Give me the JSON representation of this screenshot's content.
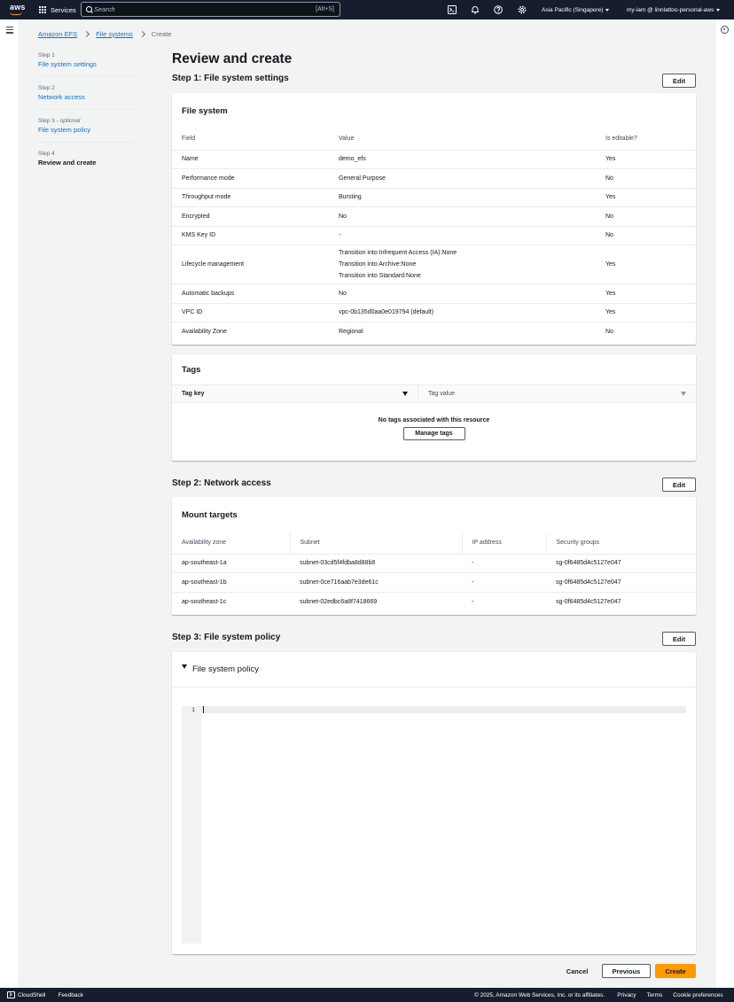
{
  "topnav": {
    "logo_text": "aws",
    "services_label": "Services",
    "search_placeholder": "Search",
    "search_shortcut": "[Alt+S]",
    "icons": [
      "cloudshell-icon",
      "bell-icon",
      "help-icon",
      "gear-icon"
    ],
    "region": "Asia Pacific (Singapore)",
    "user": "my-iam @ linnlattoo-personal-aws",
    "colors": {
      "bg": "#161e2d",
      "logo_smile": "#ff9900"
    }
  },
  "breadcrumb": {
    "items": [
      "Amazon EFS",
      "File systems"
    ],
    "current": "Create"
  },
  "steps": [
    {
      "num": "Step 1",
      "optional": "",
      "name": "File system settings"
    },
    {
      "num": "Step 2",
      "optional": "",
      "name": "Network access"
    },
    {
      "num": "Step 3",
      "optional": "optional",
      "name": "File system policy"
    },
    {
      "num": "Step 4",
      "optional": "",
      "name": "Review and create"
    }
  ],
  "page": {
    "title": "Review and create",
    "edit_label": "Edit"
  },
  "step1": {
    "title": "Step 1: File system settings",
    "file_system": {
      "header": "File system",
      "columns": [
        "Field",
        "Value",
        "Is editable?"
      ],
      "rows": [
        {
          "field": "Name",
          "value": [
            "demo_efs"
          ],
          "editable": "Yes"
        },
        {
          "field": "Performance mode",
          "value": [
            "General Purpose"
          ],
          "editable": "No"
        },
        {
          "field": "Throughput mode",
          "value": [
            "Bursting"
          ],
          "editable": "Yes"
        },
        {
          "field": "Encrypted",
          "value": [
            "No"
          ],
          "editable": "No"
        },
        {
          "field": "KMS Key ID",
          "value": [
            "-"
          ],
          "editable": "No"
        },
        {
          "field": "Lifecycle management",
          "value": [
            "Transition into Infrequent Access (IA):None",
            "Transition into Archive:None",
            "Transition into Standard:None"
          ],
          "editable": "Yes"
        },
        {
          "field": "Automatic backups",
          "value": [
            "No"
          ],
          "editable": "Yes"
        },
        {
          "field": "VPC ID",
          "value": [
            "vpc-0b135d0aa0e019794 (default)"
          ],
          "editable": "Yes"
        },
        {
          "field": "Availability Zone",
          "value": [
            "Regional"
          ],
          "editable": "No"
        }
      ]
    },
    "tags": {
      "header": "Tags",
      "col_key": "Tag key",
      "col_value": "Tag value",
      "empty": "No tags associated with this resource",
      "manage_label": "Manage tags"
    }
  },
  "step2": {
    "title": "Step 2: Network access",
    "mount_targets": {
      "header": "Mount targets",
      "columns": [
        "Availability zone",
        "Subnet",
        "IP address",
        "Security groups"
      ],
      "rows": [
        [
          "ap-southeast-1a",
          "subnet-03cd5f4fdba8d88b8",
          "-",
          "sg-0f6485d4c5127e047"
        ],
        [
          "ap-southeast-1b",
          "subnet-0ce716aab7e3de61c",
          "-",
          "sg-0f6485d4c5127e047"
        ],
        [
          "ap-southeast-1c",
          "subnet-02edbc6a8f7418669",
          "-",
          "sg-0f6485d4c5127e047"
        ]
      ]
    }
  },
  "step3": {
    "title": "Step 3: File system policy",
    "policy_header": "File system policy",
    "editor_line": "1"
  },
  "actions": {
    "cancel": "Cancel",
    "previous": "Previous",
    "create": "Create",
    "primary_color": "#ff9900"
  },
  "footer": {
    "cloudshell": "CloudShell",
    "feedback": "Feedback",
    "copyright": "© 2025, Amazon Web Services, Inc. or its affiliates.",
    "privacy": "Privacy",
    "terms": "Terms",
    "cookie": "Cookie preferences"
  }
}
